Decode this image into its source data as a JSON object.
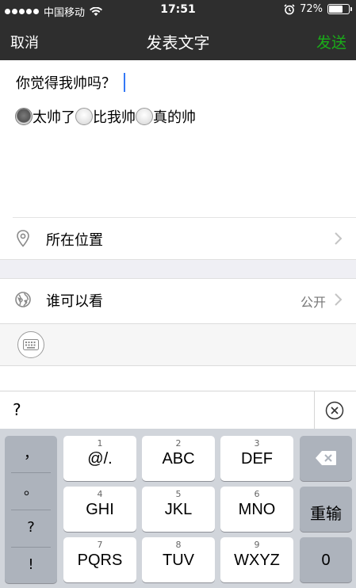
{
  "status_bar": {
    "carrier": "中国移动",
    "time": "17:51",
    "battery_percent_text": "72%",
    "battery_level": 0.72
  },
  "nav": {
    "cancel_label": "取消",
    "title": "发表文字",
    "send_label": "发送"
  },
  "compose": {
    "question": "你觉得我帅吗？",
    "options": [
      {
        "label": "太帅了",
        "checked": true
      },
      {
        "label": "比我帅",
        "checked": false
      },
      {
        "label": "真的帅",
        "checked": false
      }
    ]
  },
  "location_row": {
    "label": "所在位置",
    "icon": "location-pin-icon"
  },
  "visibility_row": {
    "label": "谁可以看",
    "value": "公开",
    "icon": "globe-icon"
  },
  "toolbar": {
    "icon": "keyboard-icon"
  },
  "candidate_bar": {
    "text": "?",
    "clear_icon": "clear-circle-icon"
  },
  "keyboard": {
    "punctuation": [
      "，",
      "。",
      "?",
      "!"
    ],
    "keys": [
      {
        "num": "1",
        "label": "@/."
      },
      {
        "num": "2",
        "label": "ABC"
      },
      {
        "num": "3",
        "label": "DEF"
      },
      {
        "num": "4",
        "label": "GHI"
      },
      {
        "num": "5",
        "label": "JKL"
      },
      {
        "num": "6",
        "label": "MNO"
      },
      {
        "num": "7",
        "label": "PQRS"
      },
      {
        "num": "8",
        "label": "TUV"
      },
      {
        "num": "9",
        "label": "WXYZ"
      }
    ],
    "backspace_icon": "backspace-icon",
    "reenter_label": "重输",
    "zero_label": "0"
  },
  "colors": {
    "bar_bg": "#2e2e2e",
    "send_green": "#1aad19",
    "caret_blue": "#3478f6",
    "keyboard_bg": "#d1d5db"
  }
}
